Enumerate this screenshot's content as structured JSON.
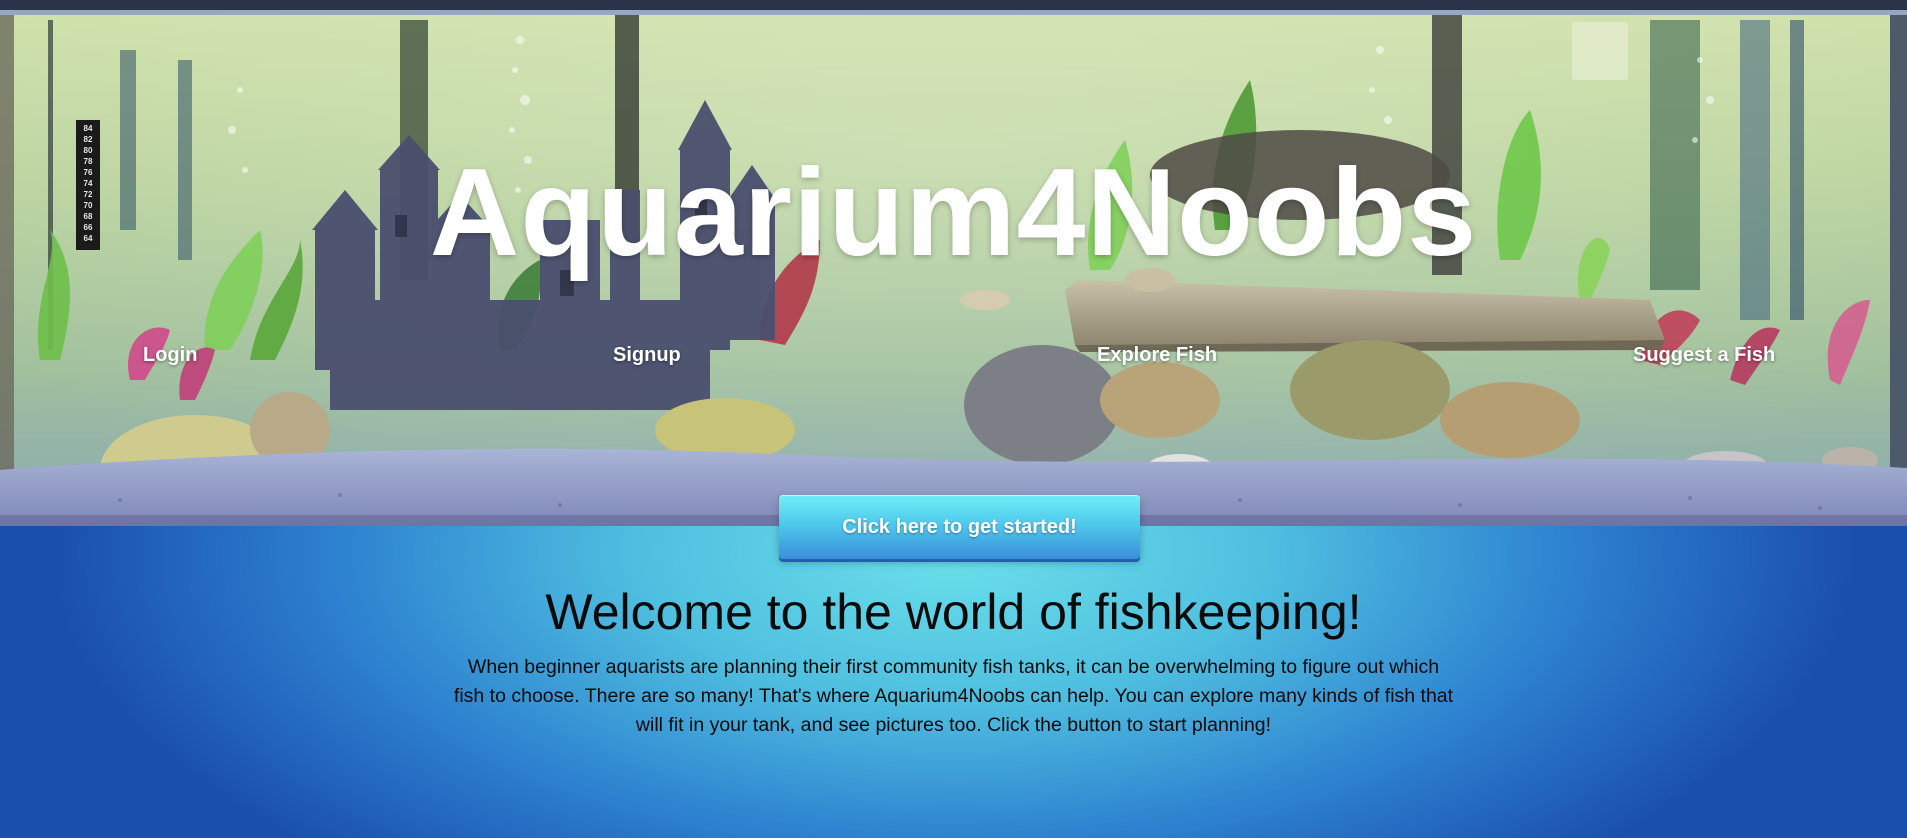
{
  "site": {
    "title": "Aquarium4Noobs"
  },
  "nav": {
    "items": [
      {
        "label": "Login"
      },
      {
        "label": "Signup"
      },
      {
        "label": "Explore Fish"
      },
      {
        "label": "Suggest a Fish"
      }
    ]
  },
  "hero": {
    "thermometer_ticks": [
      "84",
      "82",
      "80",
      "78",
      "76",
      "74",
      "72",
      "70",
      "68",
      "66",
      "64"
    ]
  },
  "cta": {
    "label": "Click here to get started!"
  },
  "welcome": {
    "title": "Welcome to the world of fishkeeping!",
    "body": "When beginner aquarists are planning their first community fish tanks, it can be overwhelming to figure out which fish to choose. There are so many! That's where Aquarium4Noobs can help. You can explore many kinds of fish that will fit in your tank, and see pictures too. Click the button to start planning!"
  },
  "colors": {
    "background_center": "#6ae0ea",
    "background_edge": "#1b4fae",
    "button_top": "#6ff0f7",
    "button_bottom": "#3a8fdc",
    "text_dark": "#0a0a0a",
    "text_light": "#ffffff"
  }
}
